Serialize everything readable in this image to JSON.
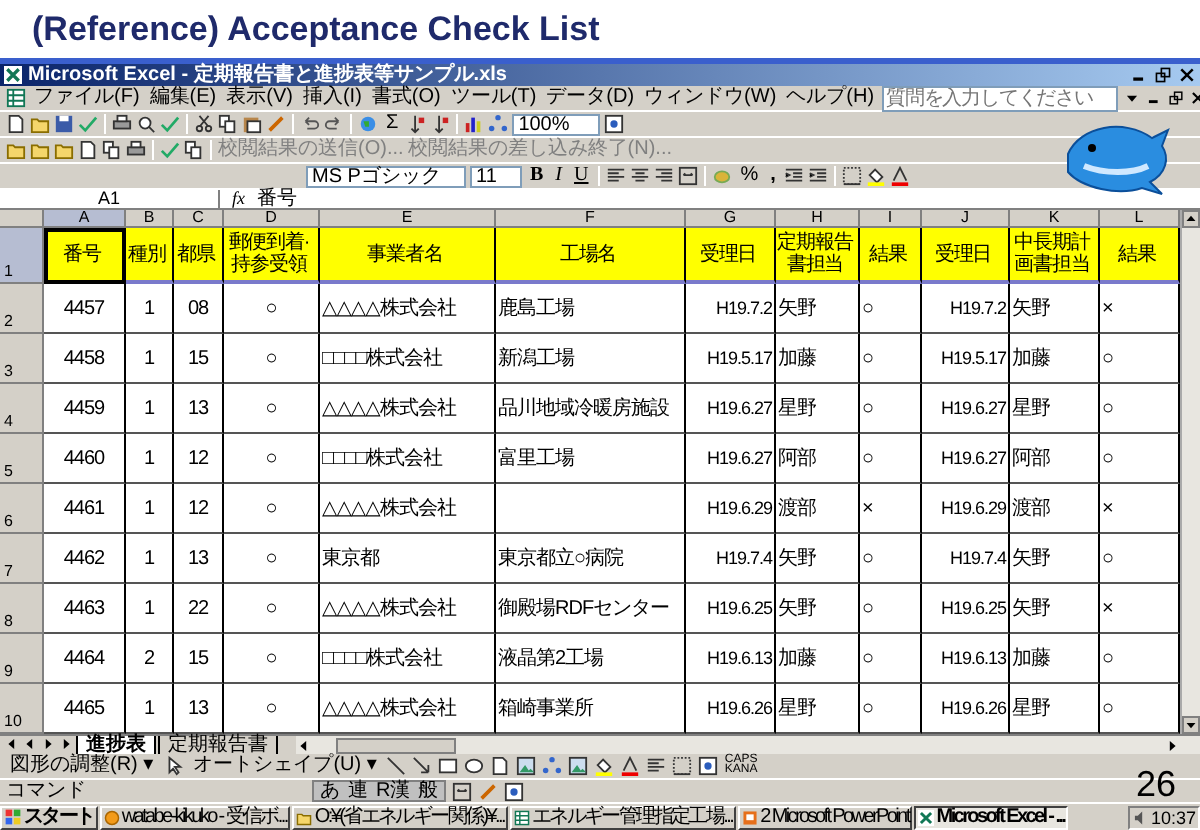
{
  "slide_title": "(Reference) Acceptance Check List",
  "page_number": "26",
  "window": {
    "title": "Microsoft Excel - 定期報告書と進捗表等サンプル.xls"
  },
  "menu": [
    "ファイル(F)",
    "編集(E)",
    "表示(V)",
    "挿入(I)",
    "書式(O)",
    "ツール(T)",
    "データ(D)",
    "ウィンドウ(W)",
    "ヘルプ(H)"
  ],
  "help_search": {
    "placeholder": "質問を入力してください"
  },
  "toolbar": {
    "sum": "Σ",
    "zoom": "100%",
    "review_send": "校閲結果の送信(O)...",
    "review_end": "校閲結果の差し込み終了(N)...",
    "font": "MS Pゴシック",
    "font_size": "11",
    "bold": "B",
    "italic": "I",
    "underline": "U",
    "percent": "%",
    "comma": ","
  },
  "formula_bar": {
    "name_box": "A1",
    "fx": "fx",
    "value": "番号"
  },
  "sheet": {
    "columns": [
      {
        "label": "A",
        "selected": true
      },
      {
        "label": "B",
        "selected": false
      },
      {
        "label": "C",
        "selected": false
      },
      {
        "label": "D",
        "selected": false
      },
      {
        "label": "E",
        "selected": false
      },
      {
        "label": "F",
        "selected": false
      },
      {
        "label": "G",
        "selected": false
      },
      {
        "label": "H",
        "selected": false
      },
      {
        "label": "I",
        "selected": false
      },
      {
        "label": "J",
        "selected": false
      },
      {
        "label": "K",
        "selected": false
      },
      {
        "label": "L",
        "selected": false
      }
    ],
    "header_row": {
      "number": "1",
      "selected": true,
      "cells": [
        "番号",
        "種別",
        "都県",
        "郵便到着·持参受領",
        "事業者名",
        "工場名",
        "受理日",
        "定期報告書担当",
        "結果",
        "受理日",
        "中長期計画書担当",
        "結果"
      ]
    },
    "rows": [
      {
        "number": "2",
        "selected": false,
        "cells": [
          "4457",
          "1",
          "08",
          "○",
          "△△△△株式会社",
          "鹿島工場",
          "H19.7.2",
          "矢野",
          "○",
          "H19.7.2",
          "矢野",
          "×"
        ]
      },
      {
        "number": "3",
        "selected": false,
        "cells": [
          "4458",
          "1",
          "15",
          "○",
          "□□□□株式会社",
          "新潟工場",
          "H19.5.17",
          "加藤",
          "○",
          "H19.5.17",
          "加藤",
          "○"
        ]
      },
      {
        "number": "4",
        "selected": false,
        "cells": [
          "4459",
          "1",
          "13",
          "○",
          "△△△△株式会社",
          "品川地域冷暖房施設",
          "H19.6.27",
          "星野",
          "○",
          "H19.6.27",
          "星野",
          "○"
        ]
      },
      {
        "number": "5",
        "selected": false,
        "cells": [
          "4460",
          "1",
          "12",
          "○",
          "□□□□株式会社",
          "富里工場",
          "H19.6.27",
          "阿部",
          "○",
          "H19.6.27",
          "阿部",
          "○"
        ]
      },
      {
        "number": "6",
        "selected": false,
        "cells": [
          "4461",
          "1",
          "12",
          "○",
          "△△△△株式会社",
          null,
          "H19.6.29",
          "渡部",
          "×",
          "H19.6.29",
          "渡部",
          "×"
        ]
      },
      {
        "number": "7",
        "selected": false,
        "cells": [
          "4462",
          "1",
          "13",
          "○",
          "東京都",
          "東京都立○病院",
          "H19.7.4",
          "矢野",
          "○",
          "H19.7.4",
          "矢野",
          "○"
        ]
      },
      {
        "number": "8",
        "selected": false,
        "cells": [
          "4463",
          "1",
          "22",
          "○",
          "△△△△株式会社",
          "御殿場RDFセンター",
          "H19.6.25",
          "矢野",
          "○",
          "H19.6.25",
          "矢野",
          "×"
        ]
      },
      {
        "number": "9",
        "selected": false,
        "cells": [
          "4464",
          "2",
          "15",
          "○",
          "□□□□株式会社",
          "液晶第2工場",
          "H19.6.13",
          "加藤",
          "○",
          "H19.6.13",
          "加藤",
          "○"
        ]
      },
      {
        "number": "10",
        "selected": false,
        "cells": [
          "4465",
          "1",
          "13",
          "○",
          "△△△△株式会社",
          "箱崎事業所",
          "H19.6.26",
          "星野",
          "○",
          "H19.6.26",
          "星野",
          "○"
        ]
      }
    ]
  },
  "sheet_tabs": [
    {
      "label": "進捗表",
      "selected": true
    },
    {
      "label": "定期報告書",
      "selected": false
    }
  ],
  "drawing_toolbar": {
    "draw": "図形の調整(R) ▾",
    "autoshape": "オートシェイプ(U) ▾"
  },
  "ime_indicators": [
    "CAPS",
    "KANA"
  ],
  "status_bar": {
    "text": "コマンド",
    "ime": [
      "あ",
      "連",
      "R漢",
      "般"
    ]
  },
  "taskbar": {
    "start": "スタート",
    "items": [
      {
        "label": "watabe-kikuko - 受信ボ...",
        "selected": false
      },
      {
        "label": "O:¥(省エネルギー関係)¥...",
        "selected": false
      },
      {
        "label": "エネルギー管理指定工場...",
        "selected": false
      },
      {
        "label": "2 Microsoft PowerPoint",
        "selected": false
      },
      {
        "label": "Microsoft Excel - ...",
        "selected": true
      }
    ],
    "clock": "10:37"
  }
}
